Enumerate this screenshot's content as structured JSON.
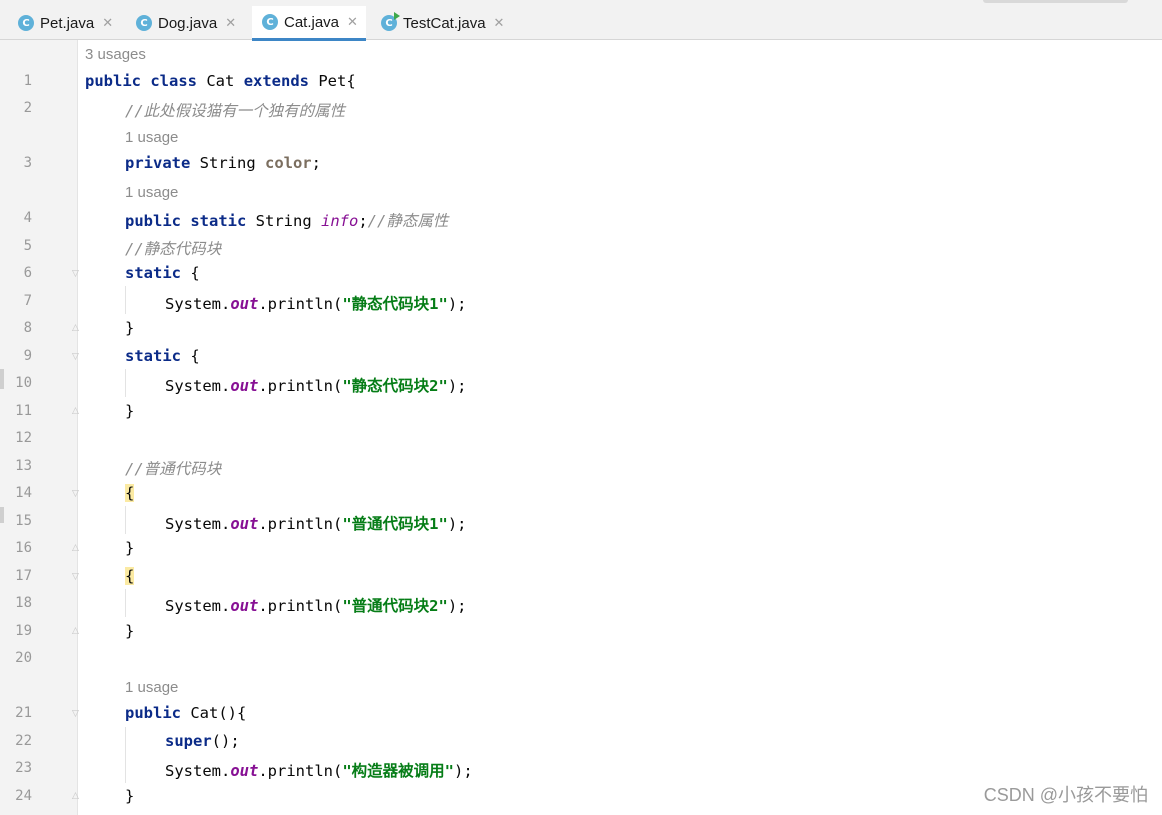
{
  "tabs": [
    {
      "label": "Pet.java",
      "active": false,
      "icon": "java-class-icon"
    },
    {
      "label": "Dog.java",
      "active": false,
      "icon": "java-class-icon"
    },
    {
      "label": "Cat.java",
      "active": true,
      "icon": "java-class-icon"
    },
    {
      "label": "TestCat.java",
      "active": false,
      "icon": "java-runnable-class-icon"
    }
  ],
  "usage_hints": {
    "class": "3 usages",
    "color_field": "1 usage",
    "info_field": "1 usage",
    "constructor": "1 usage"
  },
  "line_numbers": [
    "1",
    "2",
    "3",
    "4",
    "5",
    "6",
    "7",
    "8",
    "9",
    "10",
    "11",
    "12",
    "13",
    "14",
    "15",
    "16",
    "17",
    "18",
    "19",
    "20",
    "21",
    "22",
    "23",
    "24"
  ],
  "code": {
    "l1": {
      "kw1": "public",
      "kw2": "class",
      "name": " Cat ",
      "kw3": "extends",
      "rest": " Pet{"
    },
    "l2": {
      "comment": "//此处假设猫有一个独有的属性"
    },
    "l3": {
      "kw": "private",
      "type": " String ",
      "field": "color",
      "end": ";"
    },
    "l4": {
      "kw1": "public",
      "kw2": "static",
      "type": " String ",
      "field": "info",
      "end": ";",
      "comment": "//静态属性"
    },
    "l5": {
      "comment": "//静态代码块"
    },
    "l6": {
      "kw": "static",
      "rest": " {"
    },
    "l7": {
      "pre": "System.",
      "field": "out",
      "mid": ".println(",
      "str": "\"静态代码块1\"",
      "end": ");"
    },
    "l8": {
      "text": "}"
    },
    "l9": {
      "kw": "static",
      "rest": " {"
    },
    "l10": {
      "pre": "System.",
      "field": "out",
      "mid": ".println(",
      "str": "\"静态代码块2\"",
      "end": ");"
    },
    "l11": {
      "text": "}"
    },
    "l13": {
      "comment": "//普通代码块"
    },
    "l14": {
      "text": "{"
    },
    "l15": {
      "pre": "System.",
      "field": "out",
      "mid": ".println(",
      "str": "\"普通代码块1\"",
      "end": ");"
    },
    "l16": {
      "text": "}"
    },
    "l17": {
      "text": "{"
    },
    "l18": {
      "pre": "System.",
      "field": "out",
      "mid": ".println(",
      "str": "\"普通代码块2\"",
      "end": ");"
    },
    "l19": {
      "text": "}"
    },
    "l21": {
      "kw": "public",
      "rest": " Cat(){"
    },
    "l22": {
      "kw": "super",
      "rest": "();"
    },
    "l23": {
      "pre": "System.",
      "field": "out",
      "mid": ".println(",
      "str": "\"构造器被调用\"",
      "end": ");"
    },
    "l24": {
      "text": "}"
    }
  },
  "watermark": "CSDN @小孩不要怕",
  "colors": {
    "keyword": "#0b2b88",
    "comment": "#8c8c8c",
    "string": "#067d17",
    "static_field": "#871094",
    "tab_underline": "#3d86c6",
    "brace_highlight": "#fbeaa3"
  }
}
